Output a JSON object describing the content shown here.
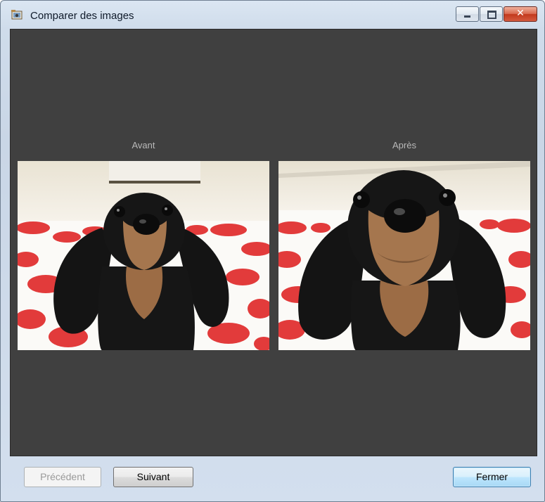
{
  "window": {
    "title": "Comparer des images",
    "icon": "photo-app-icon",
    "controls": [
      "minimize-icon",
      "maximize-icon",
      "close-icon"
    ],
    "close_glyph": "✕"
  },
  "viewer": {
    "background_color": "#404040",
    "before": {
      "label": "Avant",
      "image": "dog-photo-original"
    },
    "after": {
      "label": "Après",
      "image": "dog-photo-corrected-closeup"
    }
  },
  "buttons": {
    "previous": {
      "label": "Précédent",
      "enabled": false
    },
    "next": {
      "label": "Suivant",
      "enabled": true
    },
    "close": {
      "label": "Fermer",
      "default": true
    }
  },
  "colors": {
    "rug_flower": "#e23b3b",
    "dog_fur": "#141414",
    "dog_tan": "#a5764e"
  }
}
